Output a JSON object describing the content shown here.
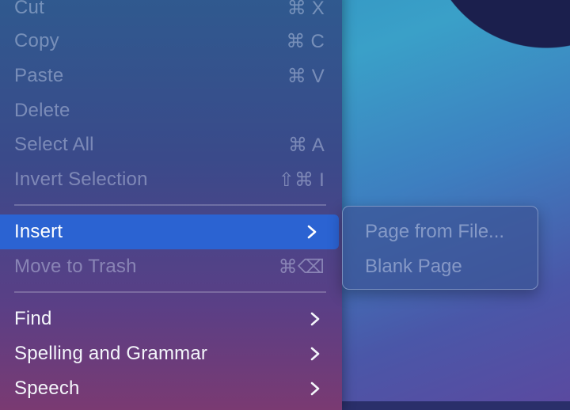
{
  "context_menu": {
    "items": [
      {
        "label": "Cut",
        "shortcut": "⌘ X",
        "state": "disabled"
      },
      {
        "label": "Copy",
        "shortcut": "⌘ C",
        "state": "disabled"
      },
      {
        "label": "Paste",
        "shortcut": "⌘ V",
        "state": "disabled"
      },
      {
        "label": "Delete",
        "shortcut": "",
        "state": "disabled"
      },
      {
        "label": "Select All",
        "shortcut": "⌘ A",
        "state": "disabled"
      },
      {
        "label": "Invert Selection",
        "shortcut": "⇧⌘  I",
        "state": "disabled"
      },
      {
        "label": "Insert",
        "shortcut": "",
        "state": "selected",
        "has_submenu": true
      },
      {
        "label": "Move to Trash",
        "shortcut": "⌘⌫",
        "state": "disabled"
      },
      {
        "label": "Find",
        "shortcut": "",
        "state": "enabled",
        "has_submenu": true
      },
      {
        "label": "Spelling and Grammar",
        "shortcut": "",
        "state": "enabled",
        "has_submenu": true
      },
      {
        "label": "Speech",
        "shortcut": "",
        "state": "enabled",
        "has_submenu": true
      }
    ]
  },
  "insert_submenu": {
    "items": [
      {
        "label": "Page from File...",
        "state": "disabled"
      },
      {
        "label": "Blank Page",
        "state": "disabled"
      }
    ]
  },
  "colors": {
    "selection": "#2b63d2",
    "enabled_text": "#f4f6fb",
    "disabled_text": "rgba(215,225,245,0.42)"
  },
  "icons": {
    "submenu_arrow": "chevron-right-icon"
  }
}
